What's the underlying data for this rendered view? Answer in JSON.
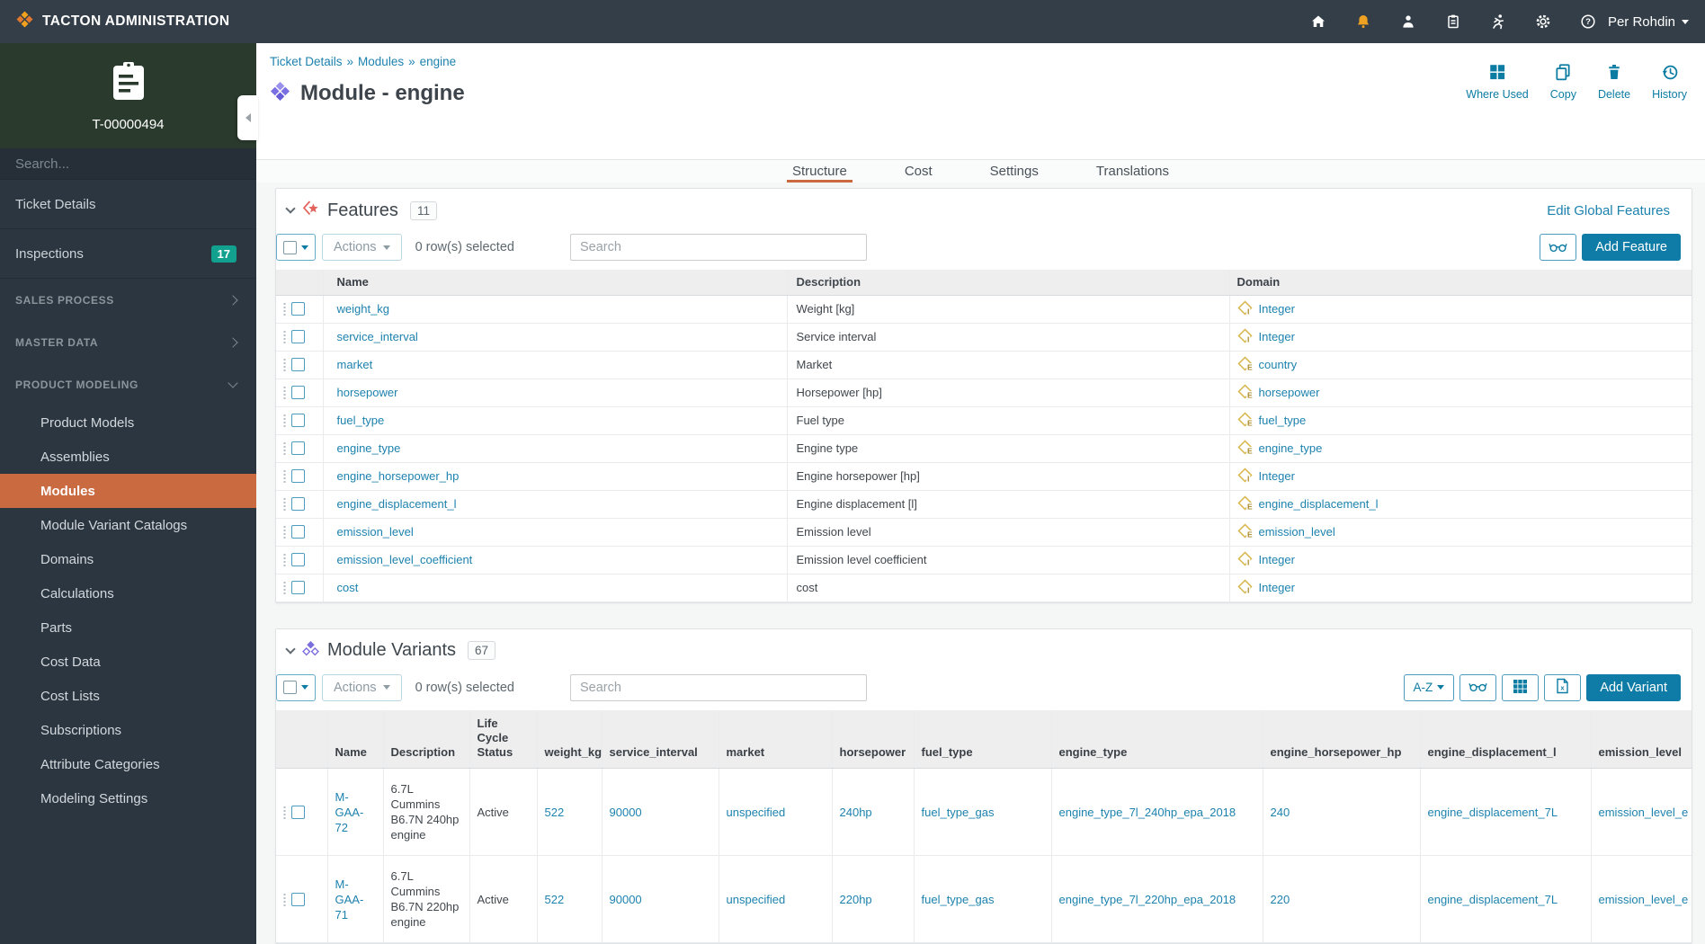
{
  "topbar": {
    "brand": "TACTON ADMINISTRATION",
    "user": "Per Rohdin"
  },
  "sidebar": {
    "ticket_id": "T-00000494",
    "search_placeholder": "Search...",
    "items": [
      {
        "label": "Ticket Details",
        "badge": ""
      },
      {
        "label": "Inspections",
        "badge": "17"
      }
    ],
    "sections": [
      {
        "label": "SALES PROCESS",
        "expanded": false,
        "children": [],
        "active_child": ""
      },
      {
        "label": "MASTER DATA",
        "expanded": false,
        "children": [],
        "active_child": ""
      },
      {
        "label": "PRODUCT MODELING",
        "expanded": true,
        "children": [
          "Product Models",
          "Assemblies",
          "Modules",
          "Module Variant Catalogs",
          "Domains",
          "Calculations",
          "Parts",
          "Cost Data",
          "Cost Lists",
          "Subscriptions",
          "Attribute Categories",
          "Modeling Settings"
        ],
        "active_child": "Modules"
      }
    ]
  },
  "header": {
    "breadcrumb": [
      "Ticket Details",
      "Modules",
      "engine"
    ],
    "separator": "»",
    "title": "Module - engine",
    "actions": [
      {
        "label": "Where Used"
      },
      {
        "label": "Copy"
      },
      {
        "label": "Delete"
      },
      {
        "label": "History"
      }
    ]
  },
  "tabs": [
    {
      "label": "Structure",
      "active": true
    },
    {
      "label": "Cost",
      "active": false
    },
    {
      "label": "Settings",
      "active": false
    },
    {
      "label": "Translations",
      "active": false
    }
  ],
  "features": {
    "title": "Features",
    "count": "11",
    "edit_link": "Edit Global Features",
    "actions_label": "Actions",
    "selected_text": "0 row(s) selected",
    "search_placeholder": "Search",
    "add_button": "Add Feature",
    "columns": [
      "Name",
      "Description",
      "Domain"
    ],
    "rows": [
      {
        "name": "weight_kg",
        "description": "Weight [kg]",
        "domain": "Integer",
        "domain_type": "I"
      },
      {
        "name": "service_interval",
        "description": "Service interval",
        "domain": "Integer",
        "domain_type": "I"
      },
      {
        "name": "market",
        "description": "Market",
        "domain": "country",
        "domain_type": "E"
      },
      {
        "name": "horsepower",
        "description": "Horsepower [hp]",
        "domain": "horsepower",
        "domain_type": "E"
      },
      {
        "name": "fuel_type",
        "description": "Fuel type",
        "domain": "fuel_type",
        "domain_type": "E"
      },
      {
        "name": "engine_type",
        "description": "Engine type",
        "domain": "engine_type",
        "domain_type": "E"
      },
      {
        "name": "engine_horsepower_hp",
        "description": "Engine horsepower [hp]",
        "domain": "Integer",
        "domain_type": "I"
      },
      {
        "name": "engine_displacement_l",
        "description": "Engine displacement [l]",
        "domain": "engine_displacement_l",
        "domain_type": "E"
      },
      {
        "name": "emission_level",
        "description": "Emission level",
        "domain": "emission_level",
        "domain_type": "E"
      },
      {
        "name": "emission_level_coefficient",
        "description": "Emission level coefficient",
        "domain": "Integer",
        "domain_type": "I"
      },
      {
        "name": "cost",
        "description": "cost",
        "domain": "Integer",
        "domain_type": "I"
      }
    ]
  },
  "variants": {
    "title": "Module Variants",
    "count": "67",
    "sort_label": "A-Z",
    "actions_label": "Actions",
    "selected_text": "0 row(s) selected",
    "search_placeholder": "Search",
    "add_button": "Add Variant",
    "columns": [
      "Name",
      "Description",
      "Life Cycle Status",
      "weight_kg",
      "service_interval",
      "market",
      "horsepower",
      "fuel_type",
      "engine_type",
      "engine_horsepower_hp",
      "engine_displacement_l",
      "emission_level"
    ],
    "rows": [
      {
        "name": "M-GAA-72",
        "description": "6.7L Cummins B6.7N 240hp engine",
        "life_cycle_status": "Active",
        "weight_kg": "522",
        "service_interval": "90000",
        "market": "unspecified",
        "horsepower": "240hp",
        "fuel_type": "fuel_type_gas",
        "engine_type": "engine_type_7l_240hp_epa_2018",
        "engine_horsepower_hp": "240",
        "engine_displacement_l": "engine_displacement_7L",
        "emission_level": "emission_level_e"
      },
      {
        "name": "M-GAA-71",
        "description": "6.7L Cummins B6.7N 220hp engine",
        "life_cycle_status": "Active",
        "weight_kg": "522",
        "service_interval": "90000",
        "market": "unspecified",
        "horsepower": "220hp",
        "fuel_type": "fuel_type_gas",
        "engine_type": "engine_type_7l_220hp_epa_2018",
        "engine_horsepower_hp": "220",
        "engine_displacement_l": "engine_displacement_7L",
        "emission_level": "emission_level_e"
      }
    ]
  },
  "colors": {
    "topbar_bg": "#333e48",
    "sidebar_bg": "#2c3640",
    "ticket_bg": "#2a3a2d",
    "active_orange": "#ca6a40",
    "tab_underline": "#c9693d",
    "link_blue": "#1d82ae",
    "button_teal": "#0e7ca6",
    "badge_teal": "#12a08f",
    "notification_orange": "#efa122",
    "domain_icon_gold": "#d8b54a",
    "feature_icon_red": "#e2635c",
    "module_icon_purple": "#7a70e2"
  }
}
